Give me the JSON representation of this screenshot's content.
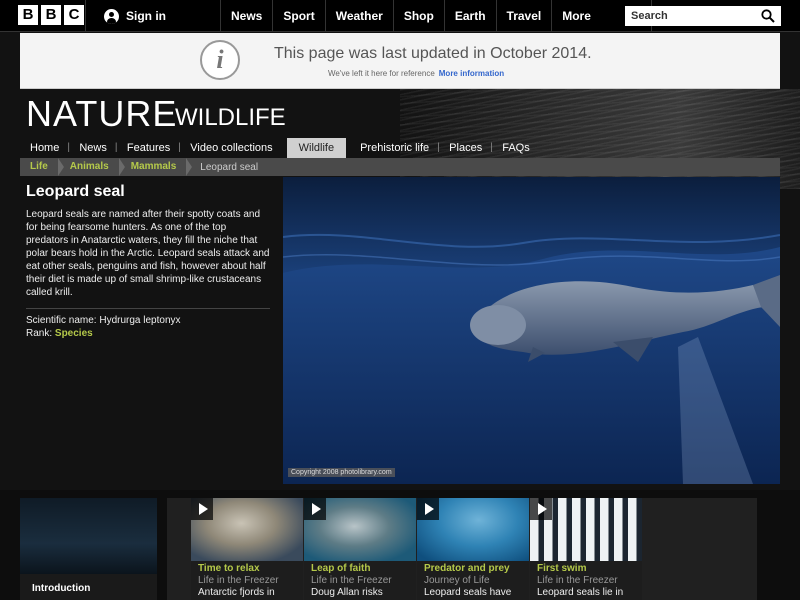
{
  "bbc_bar": {
    "logo_letters": [
      "B",
      "B",
      "C"
    ],
    "signin_label": "Sign in",
    "nav": [
      "News",
      "Sport",
      "Weather",
      "Shop",
      "Earth",
      "Travel"
    ],
    "more_label": "More",
    "search_placeholder": "Search"
  },
  "notice": {
    "title": "This page was last updated in October 2014.",
    "sub": "We've left it here for reference",
    "link": "More information"
  },
  "header": {
    "title": "NATURE",
    "subtitle": "WILDLIFE"
  },
  "section_nav": {
    "items": [
      "Home",
      "News",
      "Features",
      "Video collections",
      "Wildlife",
      "Prehistoric life",
      "Places",
      "FAQs"
    ],
    "active_index": 4
  },
  "breadcrumb": {
    "links": [
      "Life",
      "Animals",
      "Mammals"
    ],
    "current": "Leopard seal"
  },
  "species": {
    "name": "Leopard seal",
    "description": "Leopard seals are named after their spotty coats and for being fearsome hunters. As one of the top predators in Anatarctic waters, they fill the niche that polar bears hold in the Arctic. Leopard seals attack and eat other seals, penguins and fish, however about half their diet is made up of small shrimp-like crustaceans called krill.",
    "scientific_name": "Scientific name: Hydrurga leptonyx",
    "rank_label": "Rank:",
    "rank_value": "Species"
  },
  "image": {
    "copyright": "Copyright 2008 photolibrary.com"
  },
  "intro": {
    "label": "Introduction"
  },
  "clips": [
    {
      "title": "Time to relax",
      "programme": "Life in the Freezer",
      "desc": "Antarctic fjords in"
    },
    {
      "title": "Leap of faith",
      "programme": "Life in the Freezer",
      "desc": "Doug Allan risks"
    },
    {
      "title": "Predator and prey",
      "programme": "Journey of Life",
      "desc": "Leopard seals have"
    },
    {
      "title": "First swim",
      "programme": "Life in the Freezer",
      "desc": "Leopard seals lie in"
    }
  ],
  "colors": {
    "accent_green": "#b5c94a",
    "link_blue": "#3366cc",
    "background": "#121212"
  }
}
